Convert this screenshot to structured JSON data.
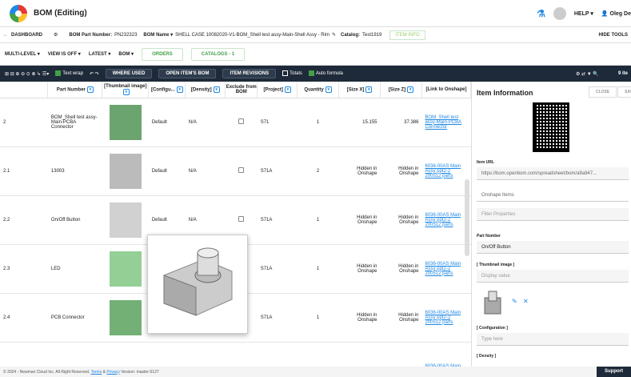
{
  "app": {
    "title": "BOM (Editing)",
    "help": "HELP ▾",
    "user": "Oleg De"
  },
  "nav": {
    "dashboard": "DASHBOARD",
    "part_number_label": "BOM Part Number:",
    "part_number": "PN232323",
    "bom_name_label": "BOM Name ▾",
    "bom_name": "SHELL CASE 10082020-V1-BOM_Shell test assy-Main-Shell Assy - Rim",
    "catalog_label": "Catalog:",
    "catalog": "Test1919",
    "item_info": "ITEM INFO",
    "hide_tools": "HIDE TOOLS"
  },
  "views": {
    "multi_level": "MULTI-LEVEL ▾",
    "view_is_off": "VIEW IS OFF ▾",
    "latest": "LATEST ▾",
    "bom": "BOM ▾",
    "orders": "ORDERS",
    "catalogs": "CATALOGS - 1"
  },
  "toolbar": {
    "text_wrap": "Text wrap",
    "where_used": "WHERE USED",
    "open_items_bom": "OPEN ITEM'S BOM",
    "item_revisions": "ITEM REVISIONS",
    "totals": "Totals",
    "auto_formula": "Auto formula",
    "items_count": "9 ite"
  },
  "table": {
    "headers": [
      "",
      "Part Number",
      "[Thumbnail image]",
      "[Configu...",
      "[Density]",
      "Exclude from BOM",
      "[Project]",
      "Quantity",
      "[Size X]",
      "[Size Z]",
      "[Link to Onshape]"
    ],
    "rows": [
      {
        "idx": "2",
        "part": "BOM_Shell test assy-Main-PCBA Connector",
        "config": "Default",
        "density": "N/A",
        "project": "S71",
        "qty": "1",
        "sizex": "15.155",
        "sizez": "37.386",
        "link": "BOM_Shell test assy-Main-PCBA Connector"
      },
      {
        "idx": "2.1",
        "part": "13003",
        "config": "Default",
        "density": "N/A",
        "project": "S71A",
        "qty": "2",
        "sizex": "Hidden in Onshape",
        "sizez": "Hidden in Onshape",
        "link": "6036-00AS Main Assy ppt2-2 200512 parts"
      },
      {
        "idx": "2.2",
        "part": "On/Off Button",
        "config": "Default",
        "density": "N/A",
        "project": "S71A",
        "qty": "1",
        "sizex": "Hidden in Onshape",
        "sizez": "Hidden in Onshape",
        "link": "6036-00AS Main Assy ppt2-2 200512 parts"
      },
      {
        "idx": "2.3",
        "part": "LED",
        "config": "",
        "density": "",
        "project": "S71A",
        "qty": "1",
        "sizex": "Hidden in Onshape",
        "sizez": "Hidden in Onshape",
        "link": "6036-00AS Main Assy ppt2-2 200512 parts"
      },
      {
        "idx": "2.4",
        "part": "PCB Connector",
        "config": "",
        "density": "",
        "project": "S71A",
        "qty": "1",
        "sizex": "Hidden in Onshape",
        "sizez": "Hidden in Onshape",
        "link": "6036-00AS Main Assy ppt2-2 200512 parts"
      },
      {
        "idx": "",
        "part": "",
        "config": "",
        "density": "",
        "project": "",
        "qty": "",
        "sizex": "",
        "sizez": "",
        "link": "6036-00AS Main"
      }
    ]
  },
  "panel": {
    "title": "Item Information",
    "close": "CLOSE",
    "save": "SAVE",
    "item_url_label": "Item URL",
    "item_url": "https://bom.openbom.com/spreadsheet/bom/a9a947...",
    "onshape_items": "Onshape Items",
    "filter_placeholder": "Filter Properties",
    "part_number_label": "Part Number",
    "part_number": "On/Off Button",
    "thumbnail_label": "[ Thumbnail image ]",
    "display_value": "Display value",
    "config_label": "[ Configuration ]",
    "type_here": "Type here",
    "density_label": "[ Density ]"
  },
  "footer": {
    "copyright": "© 2024 - Newman Cloud Inc. All Right Reserved.",
    "terms": "Terms",
    "amp": "&",
    "privacy": "Privacy",
    "version": "Version: master-5127",
    "support": "Support"
  }
}
